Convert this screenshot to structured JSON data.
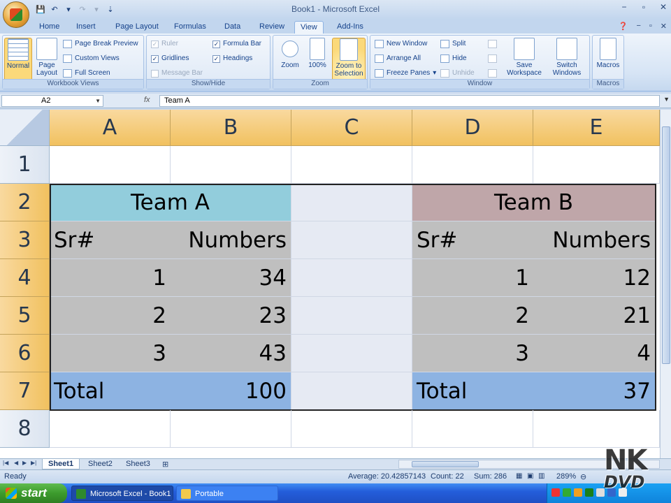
{
  "app": {
    "title": "Book1 - Microsoft Excel",
    "controls": {
      "minimize": "−",
      "restore": "▫",
      "close": "✕"
    }
  },
  "ribbon": {
    "tabs": [
      "Home",
      "Insert",
      "Page Layout",
      "Formulas",
      "Data",
      "Review",
      "View",
      "Add-Ins"
    ],
    "active_tab": "View",
    "workbook_views": {
      "label": "Workbook Views",
      "normal": "Normal",
      "page_layout": "Page Layout",
      "page_break_preview": "Page Break Preview",
      "custom_views": "Custom Views",
      "full_screen": "Full Screen"
    },
    "show_hide": {
      "label": "Show/Hide",
      "ruler": "Ruler",
      "gridlines": "Gridlines",
      "message_bar": "Message Bar",
      "formula_bar": "Formula Bar",
      "headings": "Headings"
    },
    "zoom": {
      "label": "Zoom",
      "zoom": "Zoom",
      "hundred": "100%",
      "zoom_to_selection": "Zoom to Selection"
    },
    "window": {
      "label": "Window",
      "new_window": "New Window",
      "arrange_all": "Arrange All",
      "freeze_panes": "Freeze Panes",
      "split": "Split",
      "hide": "Hide",
      "unhide": "Unhide",
      "save_workspace": "Save Workspace",
      "switch_windows": "Switch Windows"
    },
    "macros": {
      "label": "Macros",
      "macros": "Macros"
    }
  },
  "formula_bar": {
    "name_box": "A2",
    "fx": "fx",
    "value": "Team A"
  },
  "grid": {
    "columns": [
      "A",
      "B",
      "C",
      "D",
      "E"
    ],
    "rows": [
      "1",
      "2",
      "3",
      "4",
      "5",
      "6",
      "7",
      "8"
    ],
    "team_a": {
      "title": "Team A",
      "header_sr": "Sr#",
      "header_numbers": "Numbers",
      "rows": [
        {
          "sr": "1",
          "num": "34"
        },
        {
          "sr": "2",
          "num": "23"
        },
        {
          "sr": "3",
          "num": "43"
        }
      ],
      "total_label": "Total",
      "total_value": "100"
    },
    "team_b": {
      "title": "Team B",
      "header_sr": "Sr#",
      "header_numbers": "Numbers",
      "rows": [
        {
          "sr": "1",
          "num": "12"
        },
        {
          "sr": "2",
          "num": "21"
        },
        {
          "sr": "3",
          "num": "4"
        }
      ],
      "total_label": "Total",
      "total_value": "37"
    }
  },
  "colors": {
    "team_a_header": "#92cddc",
    "team_b_header": "#bfa6a9",
    "body": "#bfbfbf",
    "total": "#8db3e2"
  },
  "sheets": [
    "Sheet1",
    "Sheet2",
    "Sheet3"
  ],
  "active_sheet": "Sheet1",
  "status": {
    "ready": "Ready",
    "average": "Average: 20.42857143",
    "count": "Count: 22",
    "sum": "Sum: 286",
    "zoom": "289%"
  },
  "taskbar": {
    "start": "start",
    "items": [
      "Microsoft Excel - Book1",
      "Portable"
    ]
  },
  "watermark": {
    "line1": "NK",
    "line2": "DVD"
  }
}
